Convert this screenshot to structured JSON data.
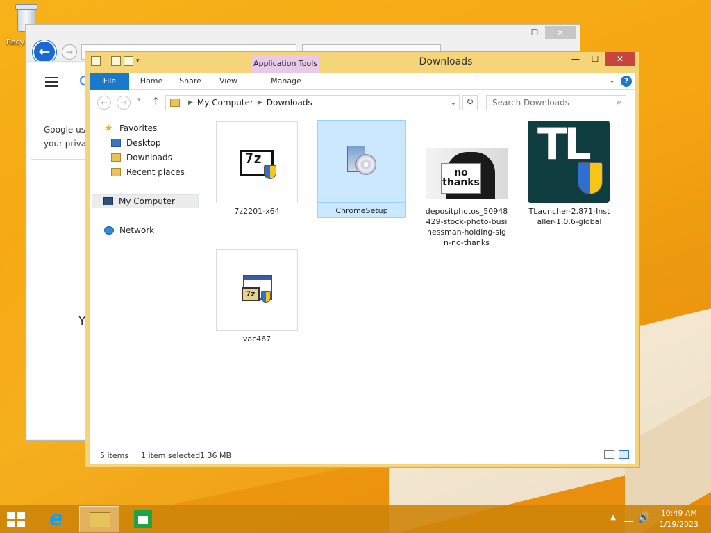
{
  "desktop": {
    "recycle_bin_label": "Recyc"
  },
  "browser": {
    "text_line1": "Google use",
    "text_line2": "your privac",
    "partial_heading": "Y"
  },
  "explorer": {
    "context_tab": "Application Tools",
    "title": "Downloads",
    "ribbon_tabs": [
      "File",
      "Home",
      "Share",
      "View",
      "Manage"
    ],
    "breadcrumb": [
      "My Computer",
      "Downloads"
    ],
    "search_placeholder": "Search Downloads",
    "nav": {
      "favorites": "Favorites",
      "desktop": "Desktop",
      "downloads": "Downloads",
      "recent": "Recent places",
      "computer": "My Computer",
      "network": "Network"
    },
    "files": [
      {
        "name": "7z2201-x64",
        "icon": "7zip-installer-icon",
        "selected": false
      },
      {
        "name": "ChromeSetup",
        "icon": "setup-cd-icon",
        "selected": true
      },
      {
        "name": "depositphotos_50948429-stock-photo-businessman-holding-sign-no-thanks",
        "label_lines": [
          "depositphotos_50948",
          "429-stock-photo-busi",
          "nessman-holding-sig",
          "n-no-thanks"
        ],
        "icon": "photo-thumbnail",
        "selected": false
      },
      {
        "name": "TLauncher-2.871-Installer-1.0.6-global",
        "label_lines": [
          "TLauncher-2.871-Inst",
          "aller-1.0.6-global"
        ],
        "icon": "tlauncher-icon",
        "selected": false
      },
      {
        "name": "vac467",
        "icon": "7zip-archive-window-icon",
        "selected": false
      }
    ],
    "photo_sign": {
      "line1": "no",
      "line2": "thanks"
    },
    "tlauncher_letters": "TL",
    "status": {
      "count": "5 items",
      "selection": "1 item selected",
      "size": "1.36 MB"
    }
  },
  "taskbar": {
    "time": "10:49 AM",
    "date": "1/19/2023"
  }
}
